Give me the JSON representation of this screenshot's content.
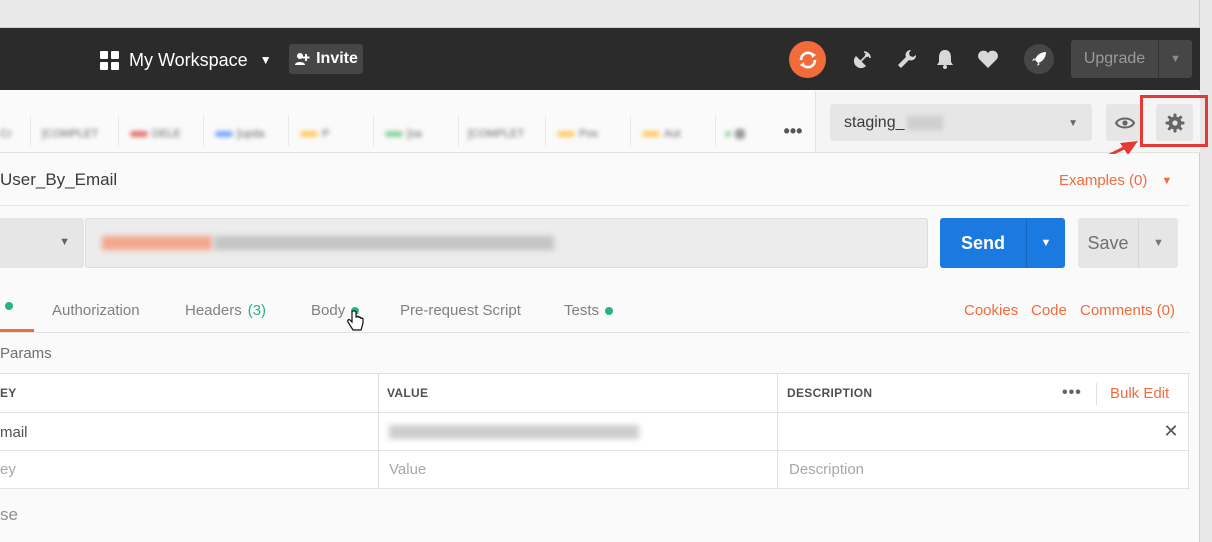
{
  "header": {
    "workspace_label": "My Workspace",
    "invite_label": "Invite",
    "upgrade_label": "Upgrade",
    "icons": [
      "sync-icon",
      "satellite-icon",
      "wrench-icon",
      "bell-icon",
      "heart-icon",
      "rocket-icon"
    ]
  },
  "tabs_row": {
    "visible_tab_fragments": [
      "Cr",
      "[COMPLET",
      "DELE",
      "[upda",
      "P",
      "[sa",
      "[COMPLET",
      "Pos",
      "Aut"
    ],
    "more_label": "•••"
  },
  "environment": {
    "selected": "staging_",
    "icons": [
      "eye-icon",
      "gear-icon"
    ]
  },
  "request": {
    "title": "User_By_Email",
    "examples_label": "Examples (0)",
    "send_label": "Send",
    "save_label": "Save"
  },
  "request_tabs": {
    "authorization": "Authorization",
    "headers": "Headers",
    "headers_count": "(3)",
    "body": "Body",
    "prerequest": "Pre-request Script",
    "tests": "Tests",
    "cookies": "Cookies",
    "code": "Code",
    "comments": "Comments (0)"
  },
  "params": {
    "title": "Params",
    "columns": [
      "EY",
      "VALUE",
      "DESCRIPTION"
    ],
    "more_label": "•••",
    "bulk_edit_label": "Bulk Edit",
    "rows": [
      {
        "key": "mail",
        "value": "",
        "description": ""
      }
    ],
    "new_row": {
      "key_ph": "ey",
      "value_ph": "Value",
      "description_ph": "Description"
    }
  },
  "response_label": "se",
  "colors": {
    "accent": "#f26b3a",
    "send_blue": "#1b7ae0",
    "header_bg": "#2b2b2b",
    "status_green": "#26b47f",
    "annotation_red": "#e53935"
  }
}
